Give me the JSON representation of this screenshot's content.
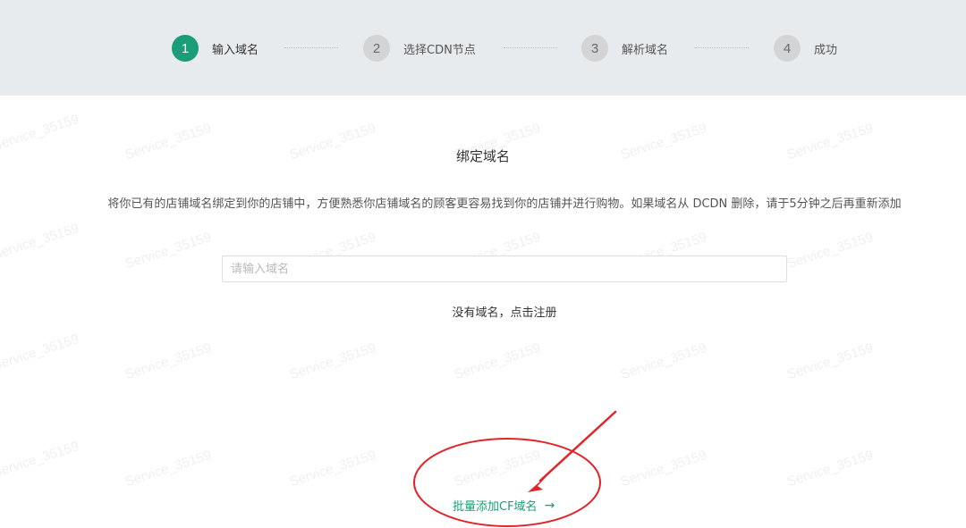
{
  "steps": [
    {
      "number": "1",
      "label": "输入域名",
      "active": true
    },
    {
      "number": "2",
      "label": "选择CDN节点",
      "active": false
    },
    {
      "number": "3",
      "label": "解析域名",
      "active": false
    },
    {
      "number": "4",
      "label": "成功",
      "active": false
    }
  ],
  "main": {
    "title": "绑定域名",
    "description": "将你已有的店铺域名绑定到你的店铺中，方便熟悉你店铺域名的顾客更容易找到你的店铺并进行购物。如果域名从 DCDN 删除，请于5分钟之后再重新添加",
    "domain_input": {
      "value": "",
      "placeholder": "请输入域名"
    },
    "register_text": "没有域名，点击注册",
    "batch_link": "批量添加CF域名"
  },
  "watermark_text": "Service_35159",
  "colors": {
    "accent": "#1a9d78",
    "annotation_red": "#e0252a",
    "stepbar_bg": "#e8ebee",
    "inactive_step": "#d3d4d6"
  }
}
